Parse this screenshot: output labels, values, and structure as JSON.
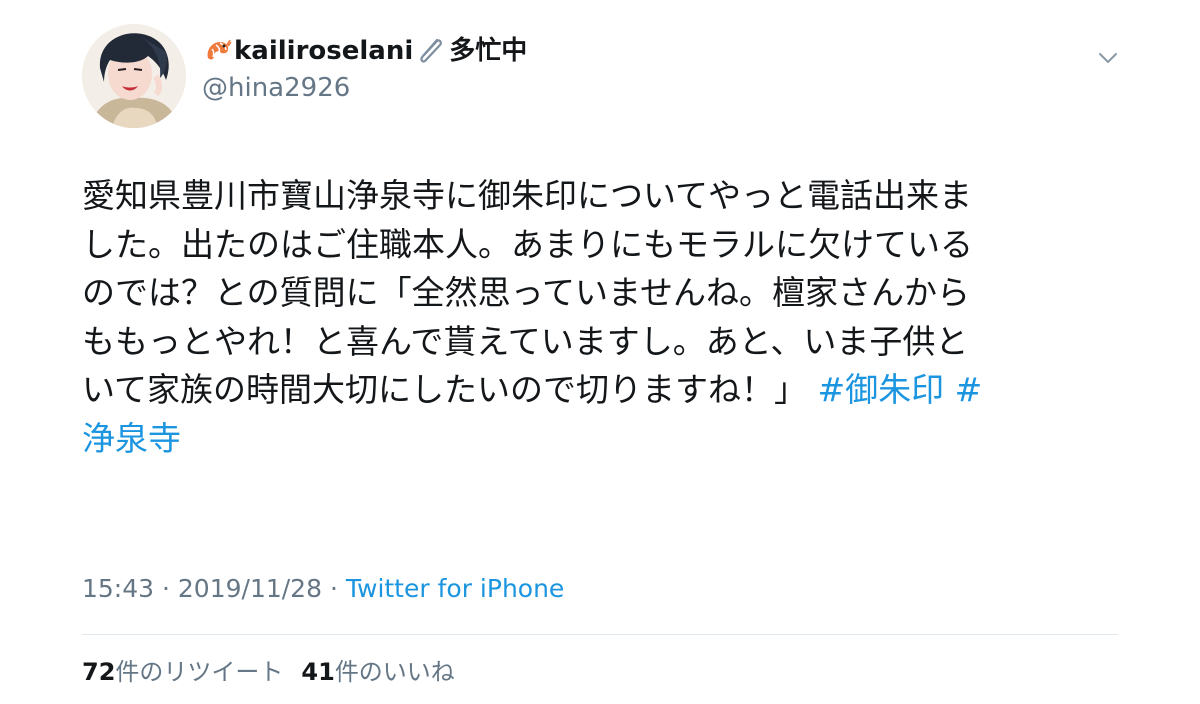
{
  "tweet": {
    "user": {
      "display_name": "kailiroselani",
      "status": "多忙中",
      "handle": "@hina2926",
      "name_icons": [
        "shrimp-icon",
        "paperclip-icon"
      ]
    },
    "text_lines": [
      "愛知県豊川市寶山浄泉寺に御朱印についてやっと電話出来ま",
      "した。出たのはご住職本人。あまりにもモラルに欠けている",
      "のでは？との質問に「全然思っていませんね。檀家さんから",
      "ももっとやれ！と喜んで貰えていますし。あと、いま子供と",
      "いて家族の時間大切にしたいので切りますね！」"
    ],
    "hashtags": [
      "#御朱印",
      "#",
      "浄泉寺"
    ],
    "time": "15:43",
    "date": "2019/11/28",
    "sep": "·",
    "source": "Twitter for iPhone",
    "retweet_count": "72",
    "retweet_label": "件のリツイート",
    "like_count": "41",
    "like_label": "件のいいね"
  },
  "colors": {
    "text": "#14171a",
    "secondary": "#657786",
    "link": "#1b95e0",
    "divider": "#e1e8ed"
  }
}
